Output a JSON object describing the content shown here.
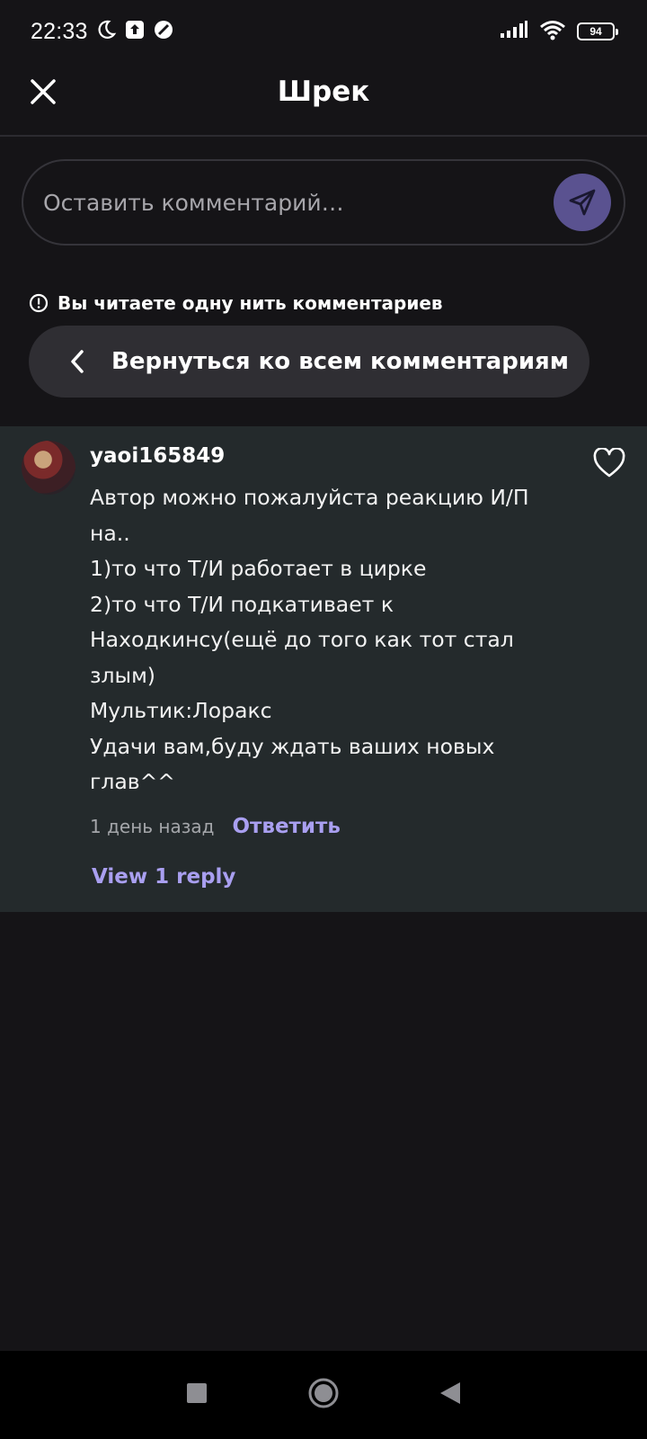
{
  "status_bar": {
    "time": "22:33",
    "battery": "94",
    "icons": [
      "moon-icon",
      "upload-icon",
      "circle-slash-icon",
      "signal-icon",
      "wifi-icon",
      "battery-icon"
    ]
  },
  "header": {
    "title": "Шрек",
    "close_icon": "close-icon"
  },
  "comment_input": {
    "placeholder": "Оставить комментарий…",
    "send_icon": "send-icon",
    "send_color": "#5a5290"
  },
  "thread": {
    "notice": "Вы читаете одну нить комментариев",
    "back_label": "Вернуться ко всем комментариям"
  },
  "comment": {
    "username": "yaoi165849",
    "text": "Автор можно пожалуйста реакцию И/П на..\n1)то что Т/И работает в цирке\n2)то что Т/И подкативает к Находкинсу(ещё до того как тот стал злым)\nМультик:Лоракс\nУдачи вам,буду ждать ваших новых глав^^",
    "timestamp": "1 день назад",
    "reply_label": "Ответить",
    "view_replies": "View 1 reply"
  },
  "colors": {
    "background": "#151417",
    "card": "#242a2c",
    "accent": "#a99ff0"
  }
}
